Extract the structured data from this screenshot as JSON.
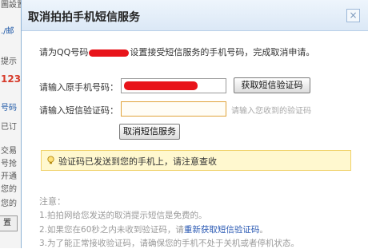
{
  "background": {
    "fragments": [
      "圖設置",
      "./邮",
      "提示",
      "123",
      "号码",
      "已订",
      "交易",
      "号抢",
      "开通",
      "您的",
      "您的"
    ],
    "button_label": "置"
  },
  "dialog": {
    "title": "取消拍拍手机短信服务",
    "close_label": "×",
    "intro_prefix": "请为QQ号码",
    "intro_suffix": "设置接受短信服务的手机号码，完成取消申请。",
    "phone_label": "请输入原手机号码：",
    "get_code_button": "获取短信验证码",
    "code_label": "请输入短信验证码：",
    "code_hint": "请输入您收到的验证码",
    "cancel_button": "取消短信服务",
    "notice": "验证码已发送到您的手机上，请注意查收",
    "notes_title": "注意：",
    "notes": [
      "1.拍拍网给您发送的取消提示短信是免费的。",
      "2.如果您在60秒之内未收到验证码，请",
      "3.为了能正常接收验证码，请确保您的手机不处于关机或者停机状态。"
    ],
    "notes_link": "重新获取短信验证码",
    "notes_link_suffix": "。"
  },
  "colors": {
    "redaction": "#e8141a",
    "link": "#2a59b3",
    "notice_bg": "#fff8cf"
  }
}
